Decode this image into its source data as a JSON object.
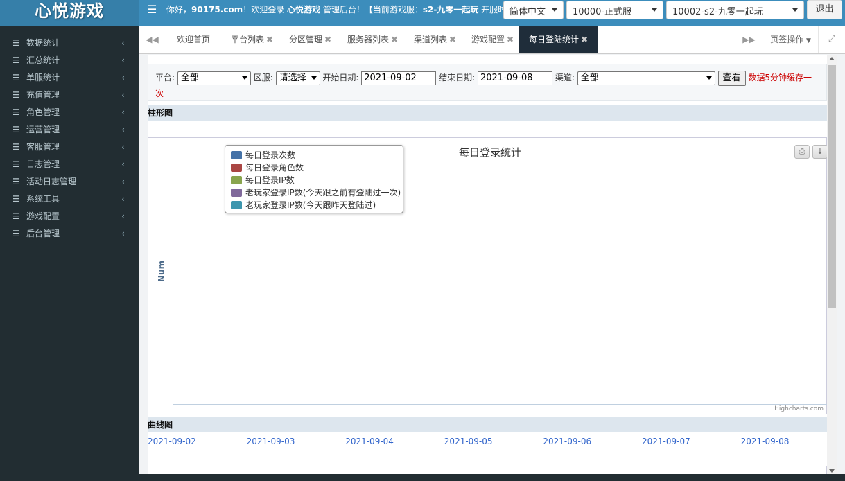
{
  "brand": {
    "logo": "心悦游戏"
  },
  "header": {
    "greeting_prefix": "你好，",
    "site": "90175.com",
    "greeting_mid": "！欢迎登录 ",
    "app_name": "心悦游戏",
    "greeting_suffix": " 管理后台！【当前游戏服：",
    "server_name": "s2-九零一起玩",
    "greeting_tail": " 开服时间",
    "language": "简体中文",
    "platform_server": "10000-正式服",
    "game_server": "10002-s2-九零一起玩",
    "logout": "退出"
  },
  "sidebar": {
    "items": [
      {
        "label": "数据统计"
      },
      {
        "label": "汇总统计"
      },
      {
        "label": "单服统计"
      },
      {
        "label": "充值管理"
      },
      {
        "label": "角色管理"
      },
      {
        "label": "运营管理"
      },
      {
        "label": "客服管理"
      },
      {
        "label": "日志管理"
      },
      {
        "label": "活动日志管理"
      },
      {
        "label": "系统工具"
      },
      {
        "label": "游戏配置"
      },
      {
        "label": "后台管理"
      }
    ]
  },
  "tabs": {
    "items": [
      {
        "label": "欢迎首页",
        "closable": false
      },
      {
        "label": "平台列表",
        "closable": true
      },
      {
        "label": "分区管理",
        "closable": true
      },
      {
        "label": "服务器列表",
        "closable": true
      },
      {
        "label": "渠道列表",
        "closable": true
      },
      {
        "label": "游戏配置",
        "closable": true
      },
      {
        "label": "每日登陆统计",
        "closable": true,
        "active": true
      }
    ],
    "ops_label": "页签操作"
  },
  "filter": {
    "platform_label": "平台:",
    "platform_value": "全部",
    "zone_label": "区服:",
    "zone_value": "请选择",
    "start_label": "开始日期:",
    "start_value": "2021-09-02",
    "end_label": "结束日期:",
    "end_value": "2021-09-08",
    "channel_label": "渠道:",
    "channel_value": "全部",
    "query_label": "查看",
    "notice": "数据5分钟缓存一次"
  },
  "sections": {
    "bar_title": "柱形图",
    "line_title": "曲线图"
  },
  "chart_data": {
    "type": "bar",
    "title": "每日登录统计",
    "ylabel": "Num",
    "xlabel": "",
    "categories": [],
    "series": [
      {
        "name": "每日登录次数",
        "color": "#4572A7",
        "values": []
      },
      {
        "name": "每日登录角色数",
        "color": "#AA4643",
        "values": []
      },
      {
        "name": "每日登录IP数",
        "color": "#89A54E",
        "values": []
      },
      {
        "name": "老玩家登录IP数(今天跟之前有登陆过一次)",
        "color": "#80699B",
        "values": []
      },
      {
        "name": "老玩家登录IP数(今天跟昨天登陆过)",
        "color": "#3D96AE",
        "values": []
      }
    ],
    "legend": "top-left",
    "credits": "Highcharts.com"
  },
  "dates": [
    "2021-09-02",
    "2021-09-03",
    "2021-09-04",
    "2021-09-05",
    "2021-09-06",
    "2021-09-07",
    "2021-09-08"
  ],
  "icons": {
    "menu": "menu-icon",
    "prev": "double-left-icon",
    "next": "double-right-icon",
    "fullscreen": "expand-icon",
    "print": "print-icon",
    "download": "download-icon"
  }
}
